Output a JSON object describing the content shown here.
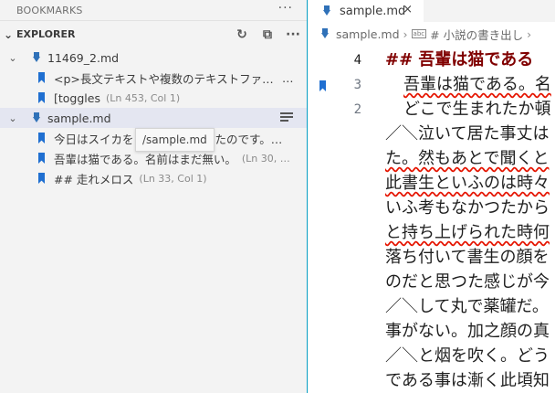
{
  "bookmarks_header": {
    "title": "BOOKMARKS",
    "more": "···"
  },
  "explorer": {
    "title": "EXPLORER",
    "actions": {
      "refresh": "↻",
      "collapse": "⧉",
      "more": "···"
    },
    "groups": [
      {
        "file": "11469_2.md",
        "items": [
          {
            "text": "<p>長文テキストや複数のテキストファイル",
            "desc": ""
          },
          {
            "text": "[toggles",
            "desc": "(Ln 453, Col 1)"
          }
        ]
      },
      {
        "file": "sample.md",
        "items": [
          {
            "text": "今日はスイカを",
            "text_tail": "たのです。…",
            "desc": ""
          },
          {
            "text": "吾輩は猫である。名前はまだ無い。",
            "desc": "(Ln 30, Col 1)"
          },
          {
            "text": "## 走れメロス",
            "desc": "(Ln 33, Col 1)"
          }
        ]
      }
    ],
    "tooltip": "/sample.md"
  },
  "editor": {
    "tab": {
      "label": "sample.md",
      "close": "×"
    },
    "breadcrumb": {
      "file": "sample.md",
      "separator": "›",
      "abc": "abc",
      "section": "# 小説の書き出し",
      "more": "›"
    },
    "lines": [
      {
        "num": "4",
        "text": "## 吾輩は猫である"
      },
      {
        "num": "3",
        "text": "吾輩は猫である。名"
      },
      {
        "num": "2",
        "text": "どこで生まれたか頓"
      },
      {
        "num": "",
        "text": "／＼泣いて居た事丈は"
      },
      {
        "num": "",
        "text": "た。然もあとで聞くと"
      },
      {
        "num": "",
        "text": "此書生といふのは時々"
      },
      {
        "num": "",
        "text": "いふ考もなかつたから"
      },
      {
        "num": "",
        "text": "と持ち上げられた時何"
      },
      {
        "num": "",
        "text": "落ち付いて書生の顔を"
      },
      {
        "num": "",
        "text": "のだと思つた感じが今"
      },
      {
        "num": "",
        "text": "／＼して丸で薬罐だ。"
      },
      {
        "num": "",
        "text": "事がない。加之顔の真"
      },
      {
        "num": "",
        "text": "／＼と烟を吹く。どう"
      },
      {
        "num": "",
        "text": "である事は漸く此頃知"
      }
    ]
  }
}
